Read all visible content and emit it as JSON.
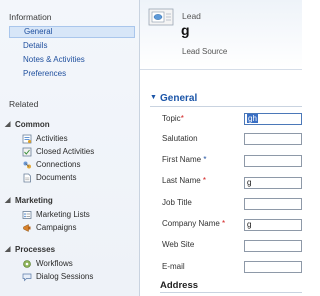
{
  "nav": {
    "information": {
      "heading": "Information",
      "links": [
        "General",
        "Details",
        "Notes & Activities",
        "Preferences"
      ]
    },
    "related": {
      "heading": "Related",
      "groups": [
        {
          "name": "Common",
          "items": [
            {
              "label": "Activities",
              "icon": "activities-icon"
            },
            {
              "label": "Closed Activities",
              "icon": "closed-activities-icon"
            },
            {
              "label": "Connections",
              "icon": "connections-icon"
            },
            {
              "label": "Documents",
              "icon": "documents-icon"
            }
          ]
        },
        {
          "name": "Marketing",
          "items": [
            {
              "label": "Marketing Lists",
              "icon": "marketing-lists-icon"
            },
            {
              "label": "Campaigns",
              "icon": "campaigns-icon"
            }
          ]
        },
        {
          "name": "Processes",
          "items": [
            {
              "label": "Workflows",
              "icon": "workflows-icon"
            },
            {
              "label": "Dialog Sessions",
              "icon": "dialog-sessions-icon"
            }
          ]
        }
      ]
    }
  },
  "header": {
    "entity_type": "Lead",
    "record_name": "g",
    "lead_source_label": "Lead Source"
  },
  "form": {
    "general_section": "General",
    "fields": [
      {
        "label": "Topic",
        "required": "*",
        "value": "gh",
        "active": true
      },
      {
        "label": "Salutation",
        "required": "",
        "value": ""
      },
      {
        "label": "First Name",
        "required": "*",
        "required_color": "blue",
        "value": ""
      },
      {
        "label": "Last Name",
        "required": "*",
        "value": "g"
      },
      {
        "label": "Job Title",
        "required": "",
        "value": ""
      },
      {
        "label": "Company Name",
        "required": "*",
        "value": "g"
      },
      {
        "label": "Web Site",
        "required": "",
        "value": ""
      },
      {
        "label": "E-mail",
        "required": "",
        "value": ""
      }
    ],
    "address_section": "Address"
  },
  "colors": {
    "accent": "#1b55a8",
    "required_red": "#d21f1f",
    "required_blue": "#1f4f9e",
    "selection": "#3a6fc4",
    "nav_selected_bg": "#d7e6f8"
  }
}
